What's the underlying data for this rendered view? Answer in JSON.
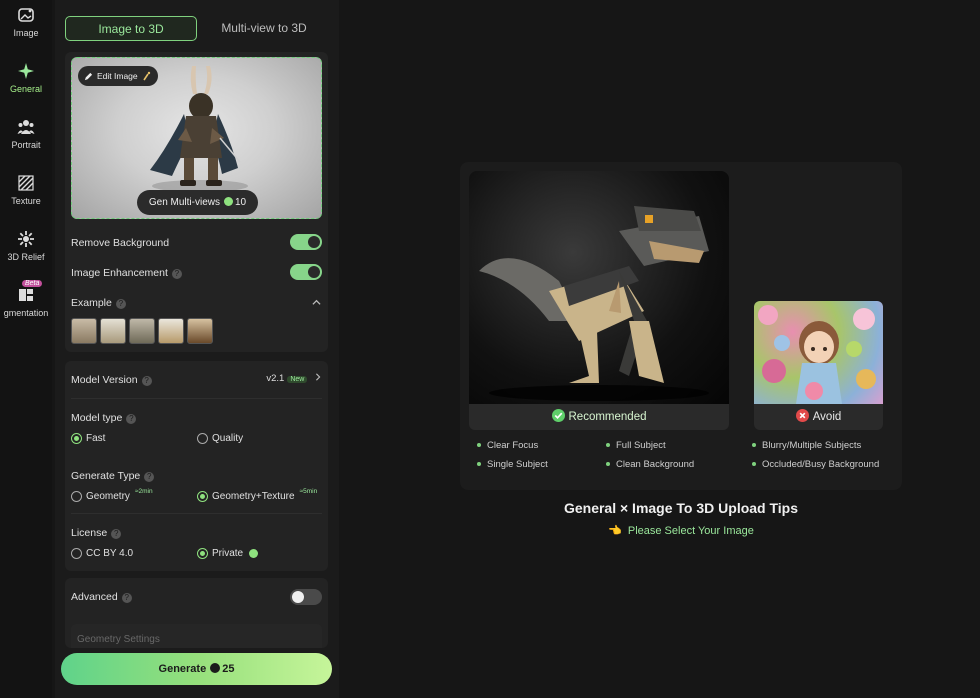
{
  "rail": [
    {
      "label": "Image",
      "icon": "image-icon"
    },
    {
      "label": "General",
      "icon": "sparkle-icon",
      "active": true
    },
    {
      "label": "Portrait",
      "icon": "people-icon"
    },
    {
      "label": "Texture",
      "icon": "texture-icon"
    },
    {
      "label": "3D Relief",
      "icon": "relief-icon"
    },
    {
      "label": "gmentation",
      "icon": "segmentation-icon",
      "badge": "Beta"
    }
  ],
  "tabs": {
    "image_to_3d": "Image to 3D",
    "multi_view": "Multi-view to 3D"
  },
  "upload": {
    "edit_label": "Edit Image",
    "gen_multiviews": "Gen Multi-views",
    "gen_multiviews_cost": "10"
  },
  "options": {
    "remove_bg": "Remove Background",
    "image_enhancement": "Image Enhancement",
    "example": "Example"
  },
  "model": {
    "version_label": "Model Version",
    "version_value": "v2.1",
    "version_badge": "New",
    "type_label": "Model type",
    "type_fast": "Fast",
    "type_quality": "Quality",
    "gen_type_label": "Generate Type",
    "gen_geometry": "Geometry",
    "gen_geometry_time": "≈2min",
    "gen_geo_texture": "Geometry+Texture",
    "gen_geo_texture_time": "≈5min",
    "license_label": "License",
    "license_cc": "CC BY 4.0",
    "license_private": "Private"
  },
  "advanced": {
    "label": "Advanced",
    "geometry_settings": "Geometry Settings"
  },
  "generate": {
    "label": "Generate",
    "cost": "25"
  },
  "tips": {
    "recommended": "Recommended",
    "avoid": "Avoid",
    "rec_items": [
      "Clear Focus",
      "Full Subject",
      "Single Subject",
      "Clean Background"
    ],
    "avoid_items": [
      "Blurry/Multiple Subjects",
      "Occluded/Busy Background"
    ],
    "title": "General × Image To 3D Upload Tips",
    "subtitle": "Please Select Your Image"
  },
  "colors": {
    "accent": "#8fe27f",
    "background": "#161616",
    "panel": "#1b1b1b",
    "card": "#232323"
  }
}
